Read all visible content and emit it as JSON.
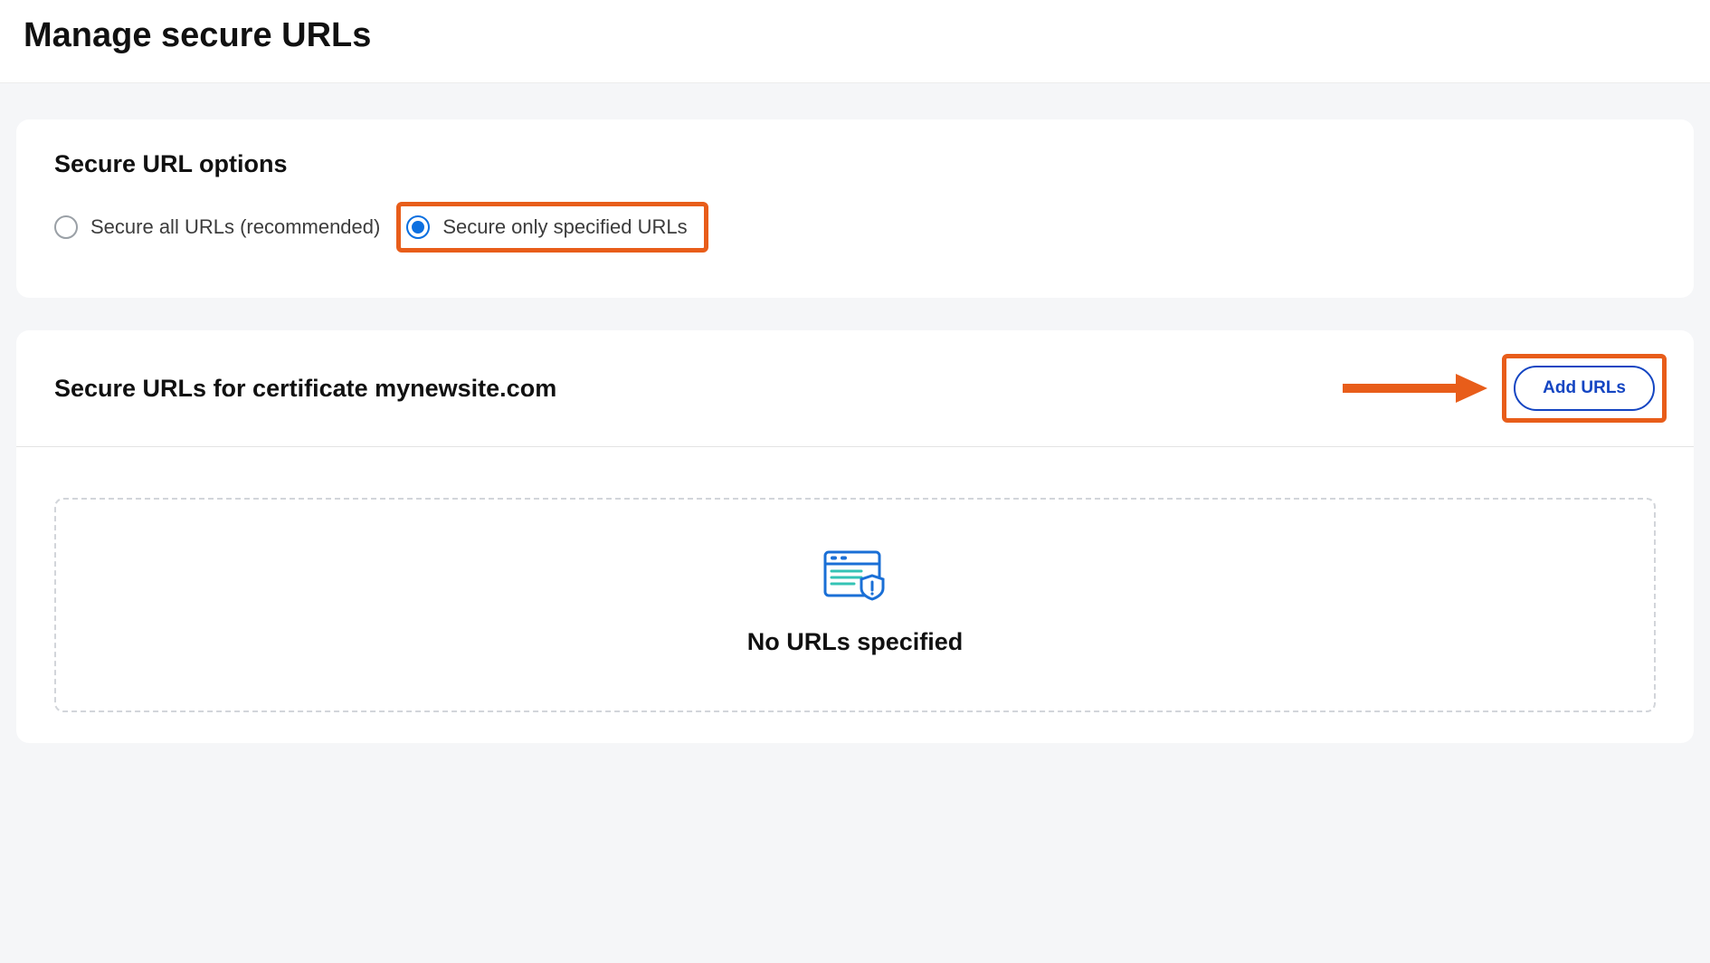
{
  "header": {
    "title": "Manage secure URLs"
  },
  "options_card": {
    "title": "Secure URL options",
    "option1_label": "Secure all URLs (recommended)",
    "option2_label": "Secure only specified URLs"
  },
  "cert_card": {
    "title": "Secure URLs for certificate mynewsite.com",
    "add_button_label": "Add URLs",
    "empty_state_text": "No URLs specified"
  }
}
